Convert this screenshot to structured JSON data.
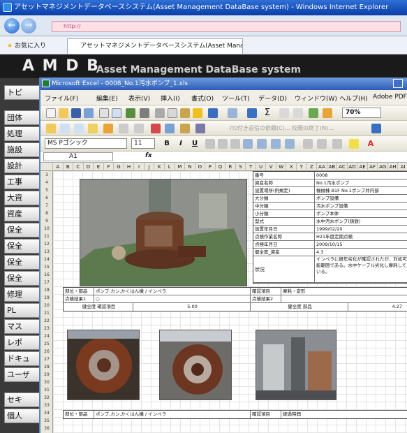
{
  "browser": {
    "title": "アセットマネジメントデータベースシステム(Asset Management DataBase system) - Windows Internet Explorer",
    "address": "http://",
    "favorites_label": "お気に入り",
    "tab_label": "アセットマネジメントデータベースシステム(Asset Manage..."
  },
  "app": {
    "logo": "A M D B",
    "subtitle": "Asset Management DataBase system"
  },
  "sidebar": {
    "items": [
      "トピ",
      "団体",
      "処理",
      "施設",
      "設計",
      "工事",
      "大資",
      "資産",
      "保全",
      "保全",
      "保全",
      "保全",
      "修理",
      "PL",
      "マス",
      "レポ",
      "ドキュ",
      "ユーザ",
      "セキ",
      "個人"
    ]
  },
  "excel": {
    "title": "Microsoft Excel - 0008_No.1汚水ポンプ_1.xls",
    "menu": [
      "ファイル(F)",
      "編集(E)",
      "表示(V)",
      "挿入(I)",
      "書式(O)",
      "ツール(T)",
      "データ(D)",
      "ウィンドウ(W)",
      "ヘルプ(H)",
      "Adobe PDF"
    ],
    "zoom": "70%",
    "review_text": "ﾏｸﾛ付き返信の依頼(C)... 校閲の終了(N)...",
    "font_name": "MS Pゴシック",
    "font_size": "11",
    "bold": "B",
    "italic": "I",
    "underline": "U",
    "name_box": "A1",
    "fx": "fx",
    "columns": [
      "A",
      "B",
      "C",
      "D",
      "E",
      "F",
      "G",
      "H",
      "I",
      "J",
      "K",
      "L",
      "M",
      "N",
      "O",
      "P",
      "Q",
      "R",
      "S",
      "T",
      "U",
      "V",
      "W",
      "X",
      "Y",
      "Z",
      "AA",
      "AB",
      "AC",
      "AD",
      "AE",
      "AF",
      "AG",
      "AH",
      "AI"
    ],
    "rows": [
      "3",
      "4",
      "5",
      "6",
      "7",
      "8",
      "9",
      "10",
      "11",
      "12",
      "13",
      "14",
      "15",
      "16",
      "17",
      "18",
      "19",
      "20",
      "21",
      "22",
      "23",
      "24",
      "25",
      "26",
      "27",
      "28",
      "29",
      "30",
      "31",
      "32",
      "33",
      "34",
      "35",
      "36"
    ]
  },
  "asset_sheet": {
    "info": [
      {
        "key": "番号",
        "value": "0008"
      },
      {
        "key": "資産名称",
        "value": "No.1汚水ポンプ"
      },
      {
        "key": "設置場所(例規定)",
        "value": "機械棟 B1F No.1ポンプ井内部"
      },
      {
        "key": "大分類",
        "value": "ポンプ設備"
      },
      {
        "key": "中分類",
        "value": "汚水ポンプ設備"
      },
      {
        "key": "小分類",
        "value": "ポンプ本体"
      },
      {
        "key": "型式",
        "value": "水中汚水ポンプ(鋳鉄)"
      },
      {
        "key": "設置年月日",
        "value": "1999/02/20"
      },
      {
        "key": "点検作業名称",
        "value": "H21年度定期点検"
      },
      {
        "key": "点検年月日",
        "value": "2009/10/15"
      },
      {
        "key": "健全度_資産",
        "value": "4.3"
      }
    ],
    "status_label": "状況",
    "status_text": "インペラに経年劣化が確認されたが、対処可能範囲である。水中ケーブル劣化し摩耗している。",
    "band1": {
      "part_label": "部位・部品",
      "part_value": "ポンプ,カン,かくはん機 / インペラ",
      "check_label": "確認項目",
      "check_value": "摩耗・変形",
      "result_label": "点検結果1",
      "result_value": "○",
      "result2_label": "点検結果2",
      "health_label": "健全度 確認項目",
      "health_value": "5.00",
      "health2_label": "健全度 部品",
      "health2_value": "4.27"
    },
    "band2": {
      "part_label": "部位・部品",
      "part_value": "ポンプ,カン,かくはん機 / インペラ",
      "check_label": "確認項目",
      "check_value": "経過時間"
    }
  }
}
